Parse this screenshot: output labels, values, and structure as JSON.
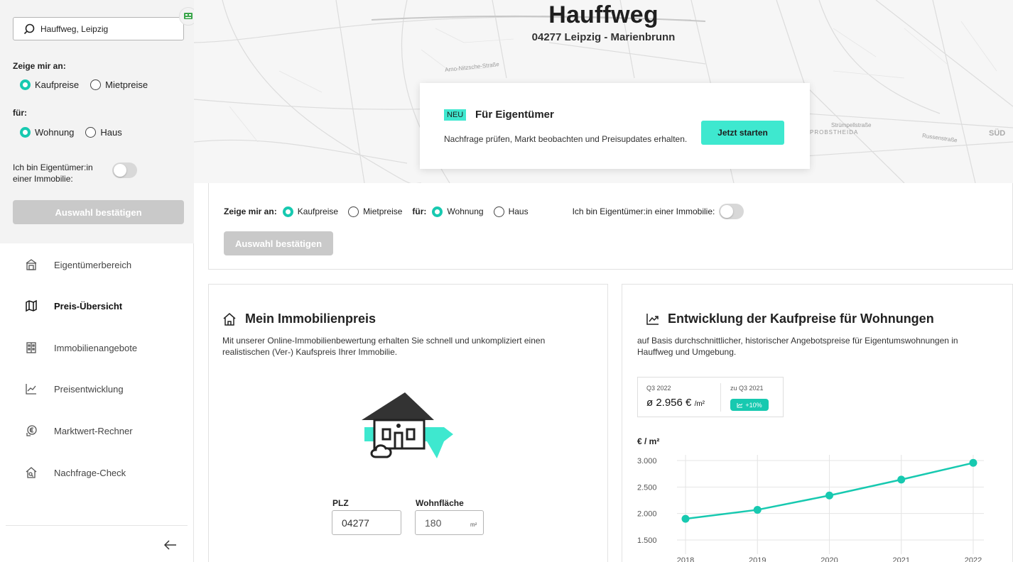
{
  "sidebar": {
    "search_value": "Hauffweg, Leipzig",
    "show_label": "Zeige mir an:",
    "show_options": [
      "Kaufpreise",
      "Mietpreise"
    ],
    "for_label": "für:",
    "for_options": [
      "Wohnung",
      "Haus"
    ],
    "owner_label": "Ich bin Eigentümer:in einer Immobilie:",
    "confirm_label": "Auswahl bestätigen",
    "nav": [
      {
        "label": "Eigentümerbereich",
        "icon": "owner-area-icon"
      },
      {
        "label": "Preis-Übersicht",
        "icon": "map-icon",
        "active": true
      },
      {
        "label": "Immobilienangebote",
        "icon": "building-icon"
      },
      {
        "label": "Preisentwicklung",
        "icon": "trend-icon"
      },
      {
        "label": "Marktwert-Rechner",
        "icon": "euro-coin-icon"
      },
      {
        "label": "Nachfrage-Check",
        "icon": "house-search-icon"
      }
    ]
  },
  "header": {
    "title": "Hauffweg",
    "subtitle": "04277 Leipzig - Marienbrunn",
    "map_labels": [
      "Arno-Nitzsche-Straße",
      "Strümpellstraße",
      "PROBSTHEIDA",
      "Russenstraße",
      "SÜD"
    ]
  },
  "owner_card": {
    "badge": "NEU",
    "title": "Für Eigentümer",
    "text": "Nachfrage prüfen, Markt beobachten und Preisupdates erhalten.",
    "cta": "Jetzt starten"
  },
  "filter_bar": {
    "show_label": "Zeige mir an:",
    "show_options": [
      "Kaufpreise",
      "Mietpreise"
    ],
    "for_label": "für:",
    "for_options": [
      "Wohnung",
      "Haus"
    ],
    "owner_label": "Ich bin Eigentümer:in einer Immobilie:",
    "confirm_label": "Auswahl bestätigen"
  },
  "price_card": {
    "title": "Mein Immobilienpreis",
    "text": "Mit unserer Online-Immobilienbewertung erhalten Sie schnell und unkompliziert einen realistischen (Ver-) Kaufspreis Ihrer Immobilie.",
    "plz_label": "PLZ",
    "plz_value": "04277",
    "area_label": "Wohnfläche",
    "area_value": "180",
    "area_unit": "m²"
  },
  "trend_card": {
    "title": "Entwicklung der Kaufpreise für Wohnungen",
    "text": "auf Basis durchschnittlicher, historischer Angebotspreise für Eigentumswohnungen in Hauffweg und Umgebung.",
    "stat_period": "Q3 2022",
    "stat_value": "ø 2.956 €",
    "stat_unit": "/m²",
    "compare_label": "zu Q3 2021",
    "compare_value": "+10%"
  },
  "colors": {
    "accent": "#17c9b0",
    "accent_light": "#3ee8cf",
    "disabled": "#c9c9c9"
  },
  "chart_data": {
    "type": "line",
    "ylabel": "€ / m²",
    "x": [
      "2018",
      "2019",
      "2020",
      "2021",
      "2022"
    ],
    "values": [
      1900,
      2070,
      2340,
      2640,
      2956
    ],
    "yticks": [
      "3.000",
      "2.500",
      "2.000",
      "1.500"
    ],
    "ylim": [
      1500,
      3000
    ],
    "grid": true,
    "color": "#17c9b0"
  }
}
